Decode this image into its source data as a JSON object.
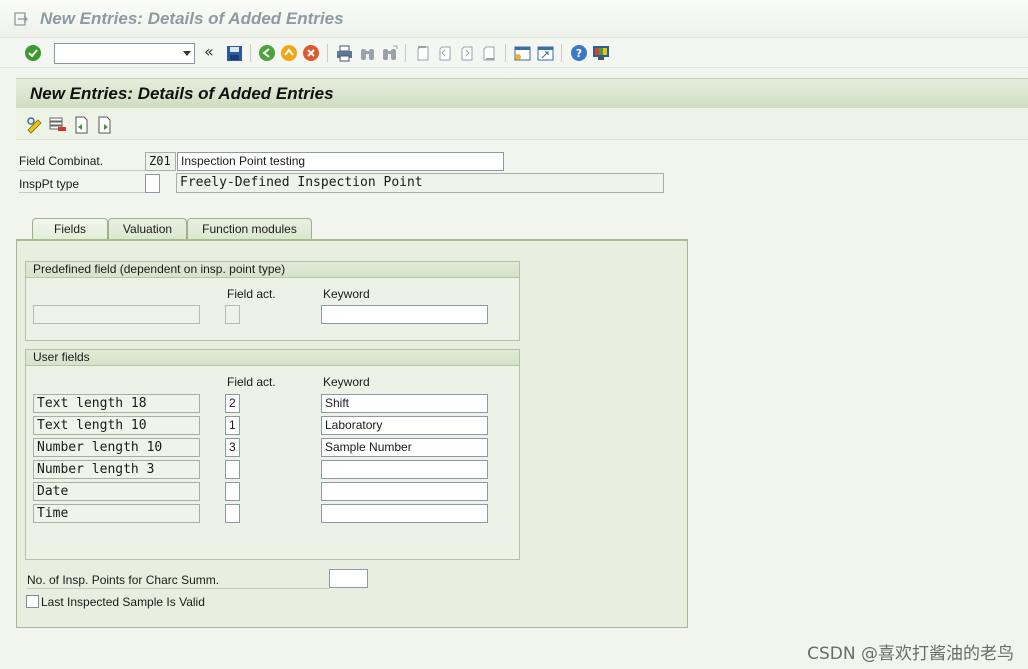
{
  "window": {
    "title": "New Entries: Details of Added Entries"
  },
  "toolbar": {
    "command_value": "",
    "double_arrow": "«"
  },
  "screen": {
    "title": "New Entries: Details of Added Entries"
  },
  "header_fields": {
    "field_combinat_label": "Field Combinat.",
    "field_combinat_value": "Z01",
    "field_combinat_desc": "Inspection Point testing",
    "insppt_type_label": "InspPt type",
    "insppt_type_value": "",
    "insppt_type_desc": "Freely-Defined Inspection Point"
  },
  "tabs": [
    {
      "label": "Fields",
      "active": true
    },
    {
      "label": "Valuation",
      "active": false
    },
    {
      "label": "Function modules",
      "active": false
    }
  ],
  "predefined_group": {
    "title": "Predefined field (dependent on insp. point type)",
    "col_field_act": "Field act.",
    "col_keyword": "Keyword",
    "field_value": "",
    "field_act_value": "",
    "keyword_value": ""
  },
  "user_group": {
    "title": "User fields",
    "col_field_act": "Field act.",
    "col_keyword": "Keyword",
    "rows": [
      {
        "field": "Text length 18",
        "act": "2",
        "keyword": "Shift"
      },
      {
        "field": "Text length 10",
        "act": "1",
        "keyword": "Laboratory"
      },
      {
        "field": "Number length 10",
        "act": "3",
        "keyword": "Sample Number"
      },
      {
        "field": "Number length 3",
        "act": "",
        "keyword": ""
      },
      {
        "field": "Date",
        "act": "",
        "keyword": ""
      },
      {
        "field": "Time",
        "act": "",
        "keyword": ""
      }
    ]
  },
  "bottom": {
    "num_insp_points_label": "No. of Insp. Points for Charc Summ.",
    "num_insp_points_value": "",
    "last_inspected_label": "Last Inspected Sample Is Valid",
    "last_inspected_checked": false
  },
  "watermark": "CSDN @喜欢打酱油的老鸟",
  "icons": [
    "menu-icon",
    "enter-icon",
    "back-icon",
    "save-icon",
    "back-green-icon",
    "exit-icon",
    "cancel-icon",
    "print-icon",
    "find-icon",
    "find-next-icon",
    "first-page-icon",
    "prev-page-icon",
    "next-page-icon",
    "last-page-icon",
    "new-session-icon",
    "shortcut-icon",
    "help-icon",
    "customize-icon",
    "change-display-icon",
    "delete-icon",
    "previous-entry-icon",
    "next-entry-icon"
  ]
}
